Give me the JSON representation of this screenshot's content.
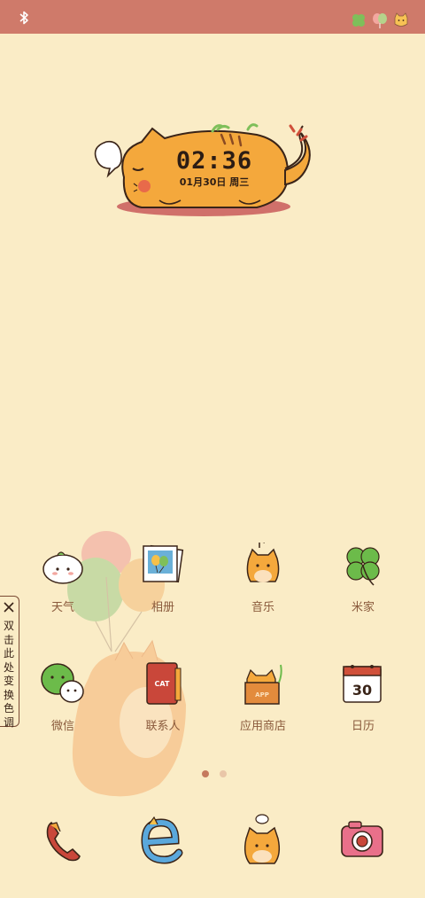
{
  "status_bar": {
    "left_icon": "bluetooth-icon",
    "right_icons": [
      "clover-icon",
      "balloon-icon",
      "cat-face-icon"
    ]
  },
  "clock_widget": {
    "time": "02:36",
    "date": "01月30日 周三"
  },
  "side_tab": {
    "close_icon": "close-icon",
    "text": "双击此处变换色调"
  },
  "home_apps": [
    {
      "label": "天气",
      "icon": "weather-icon"
    },
    {
      "label": "相册",
      "icon": "gallery-icon"
    },
    {
      "label": "音乐",
      "icon": "music-icon"
    },
    {
      "label": "米家",
      "icon": "mi-home-icon"
    },
    {
      "label": "微信",
      "icon": "wechat-icon"
    },
    {
      "label": "联系人",
      "icon": "contacts-icon"
    },
    {
      "label": "应用商店",
      "icon": "app-store-icon"
    },
    {
      "label": "日历",
      "icon": "calendar-icon",
      "day": "30"
    }
  ],
  "page_indicator": {
    "count": 2,
    "active": 0
  },
  "dock": [
    {
      "icon": "phone-icon"
    },
    {
      "icon": "browser-icon"
    },
    {
      "icon": "messages-icon"
    },
    {
      "icon": "camera-icon"
    }
  ],
  "colors": {
    "background": "#faecc6",
    "status_bar": "#cf7a6a",
    "label": "#8a5a3c",
    "cat_orange": "#f4a83c"
  }
}
